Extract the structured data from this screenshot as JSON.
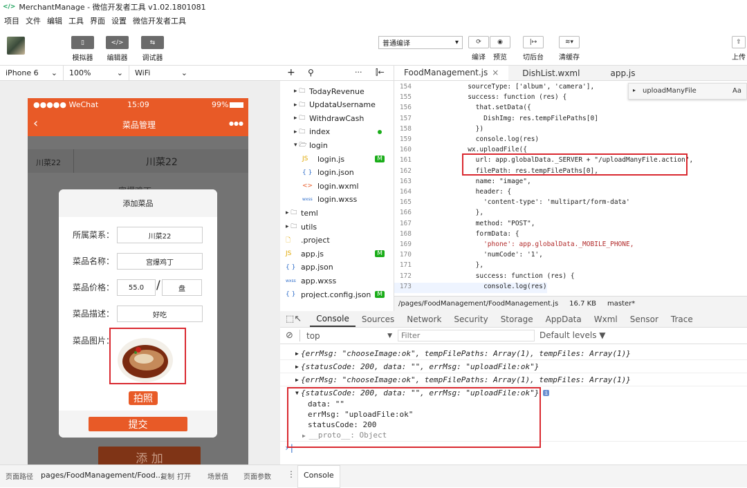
{
  "window": {
    "title": "MerchantManage - 微信开发者工具 v1.02.1801081"
  },
  "menu": [
    "项目",
    "文件",
    "编辑",
    "工具",
    "界面",
    "设置",
    "微信开发者工具"
  ],
  "toolbar": {
    "simulator": "模拟器",
    "editor": "编辑器",
    "debugger": "调试器",
    "compile_mode": "普通编译",
    "compile": "编译",
    "preview": "预览",
    "background": "切后台",
    "clear_cache": "清缓存",
    "upload": "上传"
  },
  "device": {
    "model": "iPhone 6",
    "zoom": "100%",
    "network": "WiFi"
  },
  "phone": {
    "signal": "●●●●● WeChat",
    "time": "15:09",
    "battery": "99%",
    "nav_title": "菜品管理",
    "nav_more": "●●●",
    "header_left": "川菜22",
    "header_right": "川菜22",
    "behind_text": "宫爆鸡丁",
    "modal": {
      "title": "添加菜品",
      "category_label": "所属菜系：",
      "category_value": "川菜22",
      "name_label": "菜品名称：",
      "name_value": "宫爆鸡丁",
      "price_label": "菜品价格：",
      "price_value": "55.0",
      "unit_sep": "/",
      "unit_value": "盘",
      "desc_label": "菜品描述：",
      "desc_value": "好吃",
      "image_label": "菜品图片：",
      "take_photo": "拍照",
      "submit": "提交"
    },
    "add_button": "添 加"
  },
  "bottombar": {
    "path_label": "页面路径",
    "path_value": "pages/FoodManagement/Food...",
    "copy": "复制",
    "open": "打开",
    "scene": "场景值",
    "params": "页面参数",
    "console_tab": "Console"
  },
  "filetree": {
    "items": [
      {
        "name": "TodayRevenue",
        "type": "folder"
      },
      {
        "name": "UpdataUsername",
        "type": "folder"
      },
      {
        "name": "WithdrawCash",
        "type": "folder"
      },
      {
        "name": "index",
        "type": "folder"
      },
      {
        "name": "login",
        "type": "folder-open"
      },
      {
        "name": "login.js",
        "type": "js",
        "badge": "M"
      },
      {
        "name": "login.json",
        "type": "json"
      },
      {
        "name": "login.wxml",
        "type": "wxml"
      },
      {
        "name": "login.wxss",
        "type": "wxss"
      },
      {
        "name": "teml",
        "type": "folder"
      },
      {
        "name": "utils",
        "type": "folder"
      },
      {
        "name": ".project",
        "type": "file"
      },
      {
        "name": "app.js",
        "type": "js",
        "badge": "M"
      },
      {
        "name": "app.json",
        "type": "json"
      },
      {
        "name": "app.wxss",
        "type": "wxss"
      },
      {
        "name": "project.config.json",
        "type": "json",
        "badge": "M"
      }
    ]
  },
  "editor": {
    "tabs": [
      "FoodManagement.js",
      "DishList.wxml",
      "app.js"
    ],
    "find_text": "uploadManyFile",
    "find_case": "Aa",
    "lines": [
      {
        "n": "154",
        "t": "          sourceType: ['album', 'camera'],"
      },
      {
        "n": "155",
        "t": "          success: function (res) {"
      },
      {
        "n": "156",
        "t": "            that.setData({"
      },
      {
        "n": "157",
        "t": "              DishImg: res.tempFilePaths[0]"
      },
      {
        "n": "158",
        "t": "            })"
      },
      {
        "n": "159",
        "t": "            console.log(res)"
      },
      {
        "n": "160",
        "t": "          wx.uploadFile({"
      },
      {
        "n": "161",
        "t": "            url: app.globalData._SERVER + \"/uploadManyFile.action\","
      },
      {
        "n": "162",
        "t": "            filePath: res.tempFilePaths[0],"
      },
      {
        "n": "163",
        "t": "            name: \"image\","
      },
      {
        "n": "164",
        "t": "            header: {"
      },
      {
        "n": "165",
        "t": "              'content-type': 'multipart/form-data'"
      },
      {
        "n": "166",
        "t": "            },"
      },
      {
        "n": "167",
        "t": "            method: \"POST\","
      },
      {
        "n": "168",
        "t": "            formData: {"
      },
      {
        "n": "169",
        "t": "              'phone': app.globalData._MOBILE_PHONE,"
      },
      {
        "n": "170",
        "t": "              'numCode': '1',"
      },
      {
        "n": "171",
        "t": "            },"
      },
      {
        "n": "172",
        "t": "            success: function (res) {"
      },
      {
        "n": "173",
        "t": "              console.log(res)"
      }
    ],
    "status_path": "/pages/FoodManagement/FoodManagement.js",
    "status_size": "16.7 KB",
    "status_branch": "master*"
  },
  "devtools": {
    "tabs": [
      "Console",
      "Sources",
      "Network",
      "Security",
      "Storage",
      "AppData",
      "Wxml",
      "Sensor",
      "Trace"
    ],
    "context": "top",
    "filter_placeholder": "Filter",
    "levels": "Default levels ▼"
  },
  "console": {
    "logs": [
      "{errMsg: \"chooseImage:ok\", tempFilePaths: Array(1), tempFiles: Array(1)}",
      "{statusCode: 200, data: \"\", errMsg: \"uploadFile:ok\"}",
      "{errMsg: \"chooseImage:ok\", tempFilePaths: Array(1), tempFiles: Array(1)}",
      "{statusCode: 200, data: \"\", errMsg: \"uploadFile:ok\"}"
    ],
    "expanded": [
      "data: \"\"",
      "errMsg: \"uploadFile:ok\"",
      "statusCode: 200",
      "__proto__: Object"
    ]
  },
  "colors": {
    "accent": "#e85a27",
    "highlight": "#d9282f",
    "badge": "#1aad19"
  }
}
